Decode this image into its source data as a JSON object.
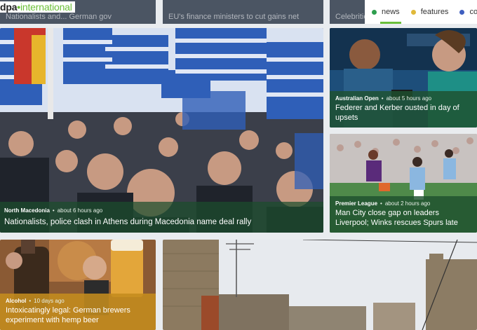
{
  "header": {
    "logo_prefix": "dpa",
    "logo_dot": "•",
    "logo_suffix": "international",
    "nav": [
      {
        "label": "news",
        "color": "#2e9e4e",
        "active": true
      },
      {
        "label": "features",
        "color": "#e0b93a",
        "active": false
      },
      {
        "label": "consu",
        "color": "#3f5fc0",
        "active": false
      }
    ]
  },
  "previous_cards": [
    "Nationalists and... German gov",
    "EU's finance ministers to cut gains net",
    "Celebrities say..."
  ],
  "cards": {
    "main": {
      "category": "North Macedonia",
      "time": "about 6 hours ago",
      "title": "Nationalists, police clash in Athens during Macedonia name deal rally"
    },
    "tennis": {
      "category": "Australian Open",
      "time": "about 5 hours ago",
      "title": "Federer and Kerber ousted in day of upsets"
    },
    "football": {
      "category": "Premier League",
      "time": "about 2 hours ago",
      "title": "Man City close gap on leaders Liverpool; Winks rescues Spurs late"
    },
    "beer": {
      "category": "Alcohol",
      "time": "10 days ago",
      "title": "Intoxicatingly legal: German brewers experiment with hemp beer"
    }
  },
  "separator": "•"
}
